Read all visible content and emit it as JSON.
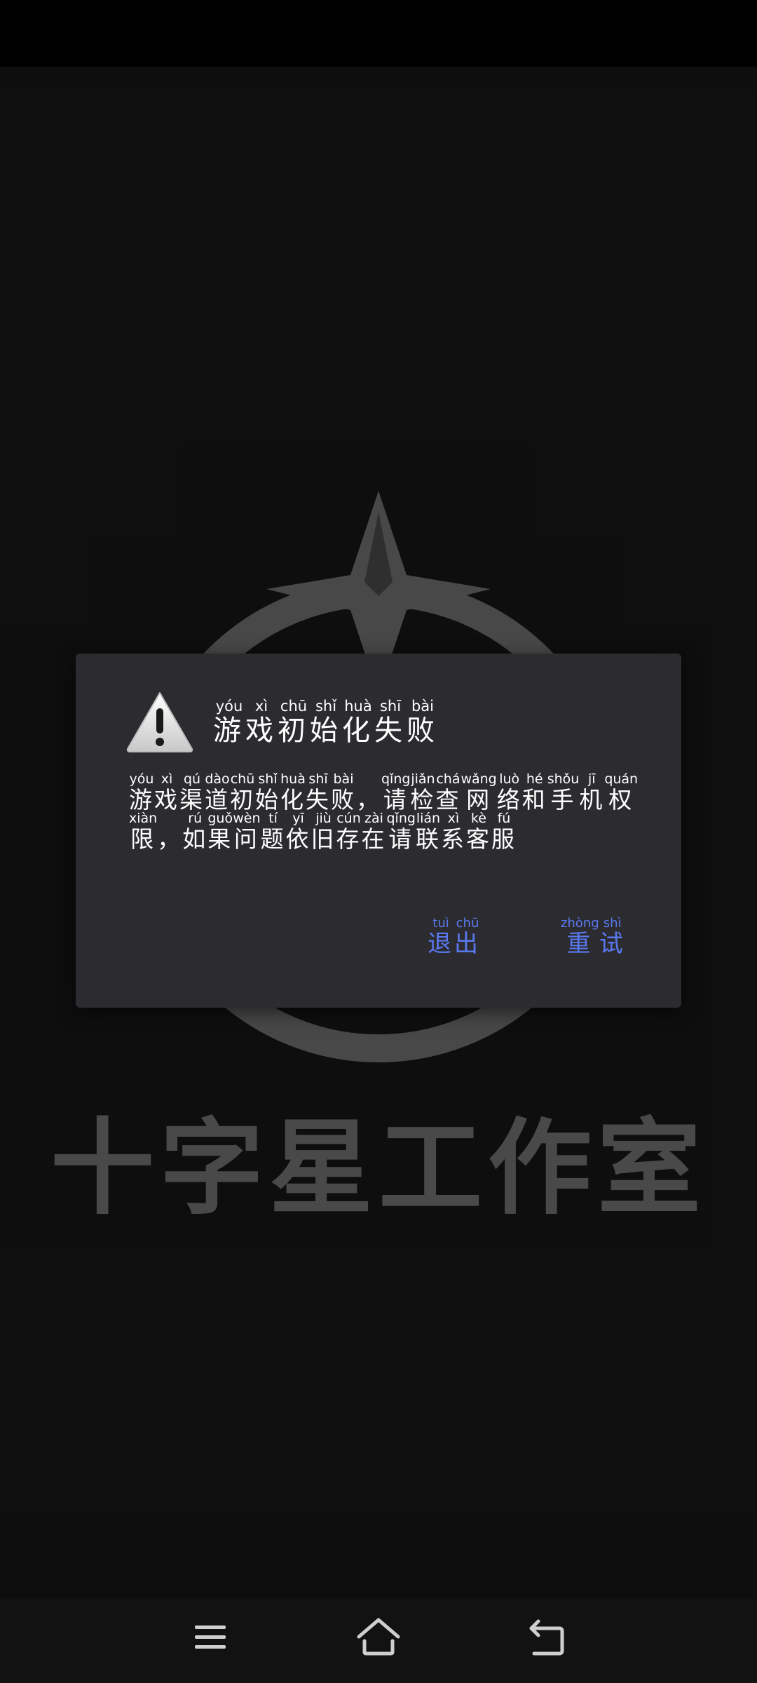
{
  "studio_name": "十字星工作室",
  "dialog": {
    "title": [
      {
        "c": "游",
        "p": "yóu"
      },
      {
        "c": "戏",
        "p": "xì"
      },
      {
        "c": "初",
        "p": "chū"
      },
      {
        "c": "始",
        "p": "shǐ"
      },
      {
        "c": "化",
        "p": "huà"
      },
      {
        "c": "失",
        "p": "shī"
      },
      {
        "c": "败",
        "p": "bài"
      }
    ],
    "message": [
      {
        "c": "游",
        "p": "yóu"
      },
      {
        "c": "戏",
        "p": "xì"
      },
      {
        "c": "渠",
        "p": "qú"
      },
      {
        "c": "道",
        "p": "dào"
      },
      {
        "c": "初",
        "p": "chū"
      },
      {
        "c": "始",
        "p": "shǐ"
      },
      {
        "c": "化",
        "p": "huà"
      },
      {
        "c": "失",
        "p": "shī"
      },
      {
        "c": "败",
        "p": "bài"
      },
      {
        "c": "，",
        "p": ""
      },
      {
        "c": "请",
        "p": "qǐng"
      },
      {
        "c": "检",
        "p": "jiǎn"
      },
      {
        "c": "查",
        "p": "chá"
      },
      {
        "c": "网",
        "p": "wǎng"
      },
      {
        "c": "络",
        "p": "luò"
      },
      {
        "c": "和",
        "p": "hé"
      },
      {
        "c": "手",
        "p": "shǒu"
      },
      {
        "c": "机",
        "p": "jī"
      },
      {
        "c": "权",
        "p": "quán"
      },
      {
        "c": "限",
        "p": "xiàn"
      },
      {
        "c": "，",
        "p": ""
      },
      {
        "c": "如",
        "p": "rú"
      },
      {
        "c": "果",
        "p": "guǒ"
      },
      {
        "c": "问",
        "p": "wèn"
      },
      {
        "c": "题",
        "p": "tí"
      },
      {
        "c": "依",
        "p": "yī"
      },
      {
        "c": "旧",
        "p": "jiù"
      },
      {
        "c": "存",
        "p": "cún"
      },
      {
        "c": "在",
        "p": "zài"
      },
      {
        "c": "请",
        "p": "qǐng"
      },
      {
        "c": "联",
        "p": "lián"
      },
      {
        "c": "系",
        "p": "xì"
      },
      {
        "c": "客",
        "p": "kè"
      },
      {
        "c": "服",
        "p": "fú"
      }
    ],
    "exit_button": [
      {
        "c": "退",
        "p": "tuì"
      },
      {
        "c": "出",
        "p": "chū"
      }
    ],
    "retry_button": [
      {
        "c": "重",
        "p": "zhòng"
      },
      {
        "c": "试",
        "p": "shì"
      }
    ]
  },
  "icons": {
    "warning": "warning-triangle-icon",
    "nav_menu": "menu-icon",
    "nav_home": "home-icon",
    "nav_back": "back-icon"
  },
  "colors": {
    "dialog_bg": "#2c2c30",
    "button_text": "#5a78f0",
    "logo_gray": "#5a5a5a"
  }
}
